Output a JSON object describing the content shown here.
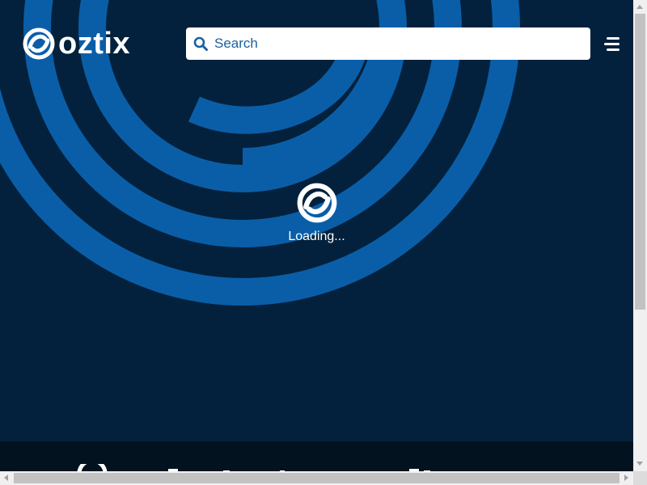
{
  "brand": {
    "name": "oztix",
    "primary_color": "#03213c",
    "accent_color": "#0a5ea8"
  },
  "search": {
    "placeholder": "Search",
    "icon": "search-icon"
  },
  "menu": {
    "icon": "hamburger-menu-icon"
  },
  "loader": {
    "icon": "oztix-swirl-icon",
    "text": "Loading..."
  },
  "footer": {
    "background_color": "#03121f"
  }
}
